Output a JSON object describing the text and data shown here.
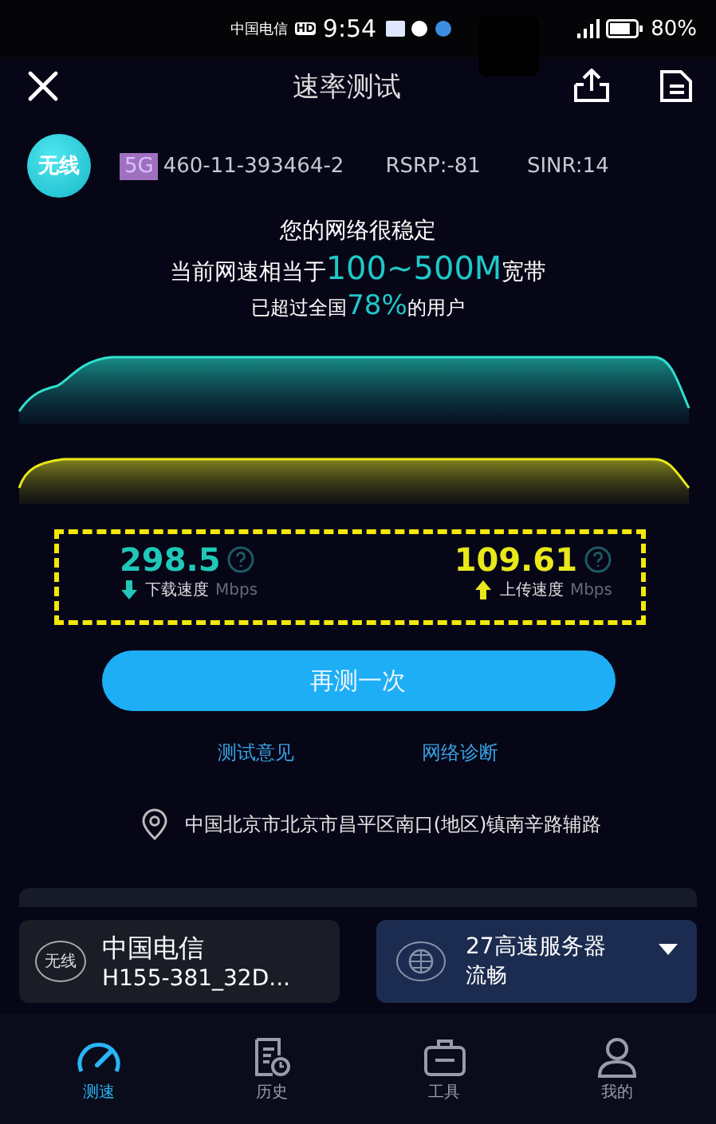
{
  "status_bar": {
    "carrier": "中国电信",
    "hd": "HD",
    "time": "9:54",
    "battery": "80%"
  },
  "header": {
    "title": "速率测试"
  },
  "network_info": {
    "type_badge": "无线",
    "gen": "5G",
    "cell_id": "460-11-393464-2",
    "rsrp": "RSRP:-81",
    "sinr": "SINR:14"
  },
  "summary": {
    "line1": "您的网络很稳定",
    "line2_prefix": "当前网速相当于",
    "line2_value": "100~500M",
    "line2_suffix": "宽带",
    "line3_prefix": "已超过全国",
    "line3_value": "78%",
    "line3_suffix": "的用户"
  },
  "results": [
    {
      "kind": "download",
      "value": "298.5",
      "label": "下载速度",
      "unit": "Mbps",
      "color": "#1fc8b8"
    },
    {
      "kind": "upload",
      "value": "109.61",
      "label": "上传速度",
      "unit": "Mbps",
      "color": "#e8e81a"
    }
  ],
  "retest_button": "再测一次",
  "links": [
    "测试意见",
    "网络诊断"
  ],
  "location": "中国北京市北京市昌平区南口(地区)镇南辛路辅路",
  "network_card": {
    "badge": "无线",
    "name": "中国电信",
    "ssid": "H155-381_32D..."
  },
  "server_card": {
    "name": "27高速服务器",
    "status": "流畅"
  },
  "nav": [
    {
      "kind": "speed",
      "label": "测速",
      "selected": true
    },
    {
      "kind": "history",
      "label": "历史",
      "selected": false
    },
    {
      "kind": "tools",
      "label": "工具",
      "selected": false
    },
    {
      "kind": "profile",
      "label": "我的",
      "selected": false
    }
  ]
}
